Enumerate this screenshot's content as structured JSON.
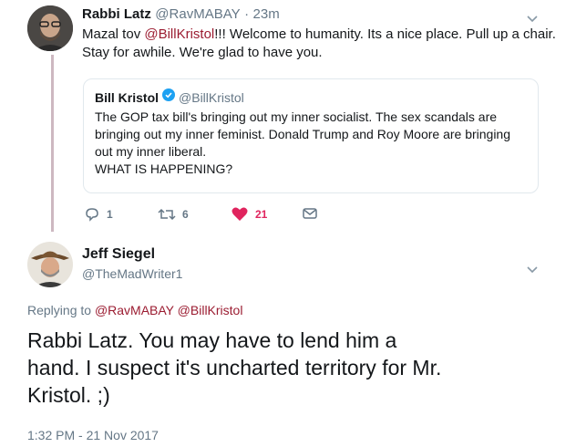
{
  "tweet1": {
    "display_name": "Rabbi Latz",
    "handle": "@RavMABAY",
    "separator": "·",
    "time": "23m",
    "text_prefix": "Mazal tov ",
    "mention": "@BillKristol",
    "text_line1_rest": "!!! Welcome to humanity. Its a nice place. Pull up a chair.",
    "text_line2": "Stay for awhile. We're glad to have you."
  },
  "quoted": {
    "display_name": "Bill Kristol",
    "handle": "@BillKristol",
    "lines": [
      "The GOP tax bill's bringing out my inner socialist. The sex scandals are",
      "bringing out my inner feminist. Donald Trump and Roy Moore are bringing",
      "out my inner liberal.",
      "WHAT IS HAPPENING?"
    ]
  },
  "actions": {
    "replies": "1",
    "retweets": "6",
    "likes": "21"
  },
  "tweet2": {
    "display_name": "Jeff Siegel",
    "handle": "@TheMadWriter1",
    "replying_to_label": "Replying to ",
    "reply_mention1": "@RavMABAY",
    "reply_mention2": "@BillKristol",
    "text_lines": [
      "Rabbi Latz. You may have to lend him a",
      "hand. I suspect it's uncharted territory for Mr.",
      "Kristol. ;)"
    ],
    "timestamp": "1:32 PM - 21 Nov 2017"
  },
  "colors": {
    "mention": "#9b1c31",
    "like": "#e0245e",
    "verified": "#1da1f2",
    "thread_line": "#cdb8c1"
  },
  "icons": [
    "chevron-down-icon",
    "verified-badge-icon",
    "reply-icon",
    "retweet-icon",
    "heart-icon",
    "direct-message-icon"
  ]
}
